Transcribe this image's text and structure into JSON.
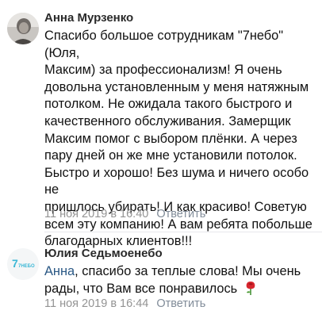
{
  "comments": [
    {
      "author": "Анна Мурзенко",
      "text_lines": [
        "Спасибо большое сотрудникам \"7небо\" (Юля,",
        "Максим) за профессионализм! Я очень",
        "довольна установленным у меня натяжным",
        "потолком. Не ожидала такого быстрого и",
        "качественного обслуживания. Замерщик",
        "Максим помог с выбором плёнки. А через",
        "пару дней он же мне установили потолок.",
        "Быстро и хорошо! Без шума и ничего особо не",
        "пришлось убирать! И как красиво! Советую",
        "всем эту компанию! А вам ребята побольше",
        "благодарных клиентов!!!"
      ],
      "timestamp": "11 ноя 2019 в 16:40",
      "reply_label": "Ответить"
    },
    {
      "author": "Юлия Седьмоенебо",
      "avatar_logo_text": "7НЕБО",
      "reply_to": "Анна",
      "text_line1_rest": ", спасибо за теплые слова! Мы очень",
      "text_line2": "рады, что Вам все понравилось",
      "emoji": "rose",
      "timestamp": "11 ноя 2019 в 16:44",
      "reply_label": "Ответить"
    }
  ],
  "colors": {
    "author": "#2a2a2a",
    "link": "#2a5885",
    "meta": "#939393",
    "divider": "#e7e8ec",
    "logo": "#3cb8d6"
  }
}
